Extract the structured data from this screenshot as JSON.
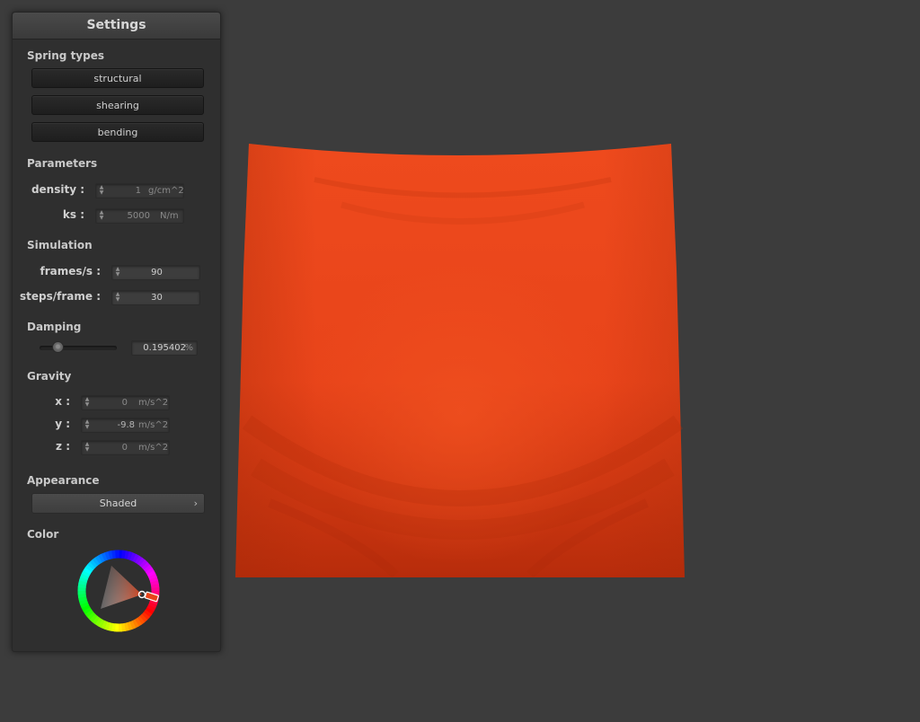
{
  "panel": {
    "title": "Settings",
    "spring_types": {
      "label": "Spring types",
      "buttons": [
        "structural",
        "shearing",
        "bending"
      ]
    },
    "parameters": {
      "label": "Parameters",
      "density": {
        "label": "density :",
        "value": "1",
        "unit": "g/cm^2"
      },
      "ks": {
        "label": "ks :",
        "value": "5000",
        "unit": "N/m"
      }
    },
    "simulation": {
      "label": "Simulation",
      "fps": {
        "label": "frames/s :",
        "value": "90"
      },
      "steps": {
        "label": "steps/frame :",
        "value": "30"
      }
    },
    "damping": {
      "label": "Damping",
      "value": "0.195402",
      "unit": "%",
      "slider_fraction": 0.2
    },
    "gravity": {
      "label": "Gravity",
      "x": {
        "label": "x :",
        "value": "0",
        "unit": "m/s^2"
      },
      "y": {
        "label": "y :",
        "value": "-9.8",
        "unit": "m/s^2"
      },
      "z": {
        "label": "z :",
        "value": "0",
        "unit": "m/s^2"
      }
    },
    "appearance": {
      "label": "Appearance",
      "selected": "Shaded"
    },
    "color": {
      "label": "Color",
      "value_hex": "#e8441a"
    }
  },
  "icons": {
    "spinner": "spinner-arrows-icon",
    "dropdown": "chevron-right-icon"
  },
  "colors": {
    "background": "#3c3c3c",
    "panel": "#2f2f2f",
    "cloth": "#e8441a"
  }
}
